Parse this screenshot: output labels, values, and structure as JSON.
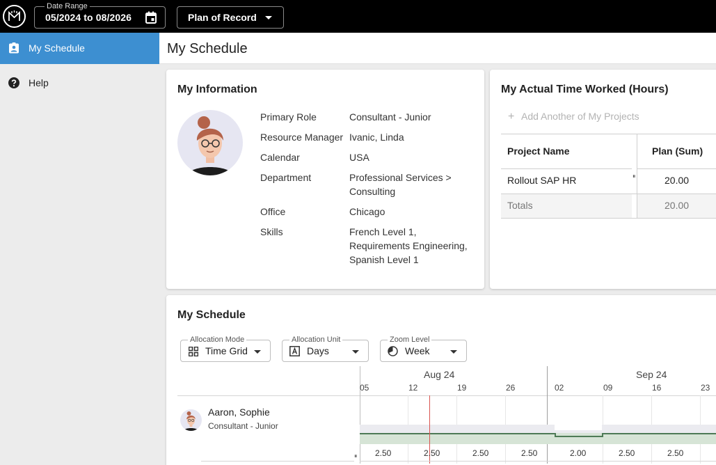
{
  "topbar": {
    "date_range_label": "Date Range",
    "date_range_value": "05/2024 to 08/2026",
    "plan_value": "Plan of Record"
  },
  "sidebar": {
    "items": [
      {
        "label": "My Schedule",
        "icon": "contact-card-icon",
        "active": true
      },
      {
        "label": "Help",
        "icon": "help-circle-icon",
        "active": false
      }
    ]
  },
  "page": {
    "title": "My Schedule"
  },
  "my_information": {
    "title": "My Information",
    "rows": [
      {
        "label": "Primary Role",
        "value": "Consultant - Junior"
      },
      {
        "label": "Resource Manager",
        "value": "Ivanic, Linda"
      },
      {
        "label": "Calendar",
        "value": "USA"
      },
      {
        "label": "Department",
        "value": "Professional Services > Consulting"
      },
      {
        "label": "Office",
        "value": "Chicago"
      },
      {
        "label": "Skills",
        "value": "French Level 1, Requirements Engineering, Spanish Level 1"
      }
    ]
  },
  "actual_time": {
    "title": "My Actual Time Worked (Hours)",
    "add_project": "Add Another of My Projects",
    "columns": [
      "Project Name",
      "Plan (Sum)"
    ],
    "rows": [
      {
        "name": "Rollout SAP HR",
        "plan": "20.00"
      }
    ],
    "totals_label": "Totals",
    "totals_value": "20.00"
  },
  "schedule": {
    "title": "My Schedule",
    "allocation_mode": {
      "label": "Allocation Mode",
      "value": "Time Grid"
    },
    "allocation_unit": {
      "label": "Allocation Unit",
      "value": "Days"
    },
    "zoom_level": {
      "label": "Zoom Level",
      "value": "Week"
    },
    "months": [
      "Aug 24",
      "Sep 24"
    ],
    "weeks": [
      "05",
      "12",
      "19",
      "26",
      "02",
      "09",
      "16",
      "23"
    ],
    "person": {
      "name": "Aaron, Sophie",
      "role": "Consultant - Junior"
    },
    "values": [
      "2.50",
      "2.50",
      "2.50",
      "2.50",
      "2.00",
      "2.50",
      "2.50"
    ]
  },
  "colors": {
    "accent": "#3d8fd1",
    "topbar": "#000000",
    "today_line": "#d9534f",
    "allocation_band": "#d6e4d6"
  }
}
